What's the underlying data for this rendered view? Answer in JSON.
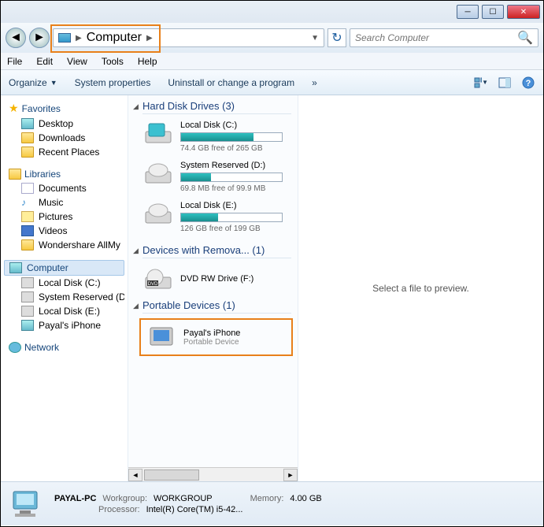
{
  "titlebar": {},
  "breadcrumb": {
    "location": "Computer"
  },
  "search": {
    "placeholder": "Search Computer"
  },
  "menu": {
    "file": "File",
    "edit": "Edit",
    "view": "View",
    "tools": "Tools",
    "help": "Help"
  },
  "toolbar": {
    "organize": "Organize",
    "sysprops": "System properties",
    "uninstall": "Uninstall or change a program",
    "more": "»"
  },
  "sidebar": {
    "favorites": {
      "label": "Favorites",
      "items": [
        {
          "label": "Desktop"
        },
        {
          "label": "Downloads"
        },
        {
          "label": "Recent Places"
        }
      ]
    },
    "libraries": {
      "label": "Libraries",
      "items": [
        {
          "label": "Documents"
        },
        {
          "label": "Music"
        },
        {
          "label": "Pictures"
        },
        {
          "label": "Videos"
        },
        {
          "label": "Wondershare AllMy"
        }
      ]
    },
    "computer": {
      "label": "Computer",
      "items": [
        {
          "label": "Local Disk (C:)"
        },
        {
          "label": "System Reserved (D:"
        },
        {
          "label": "Local Disk (E:)"
        },
        {
          "label": "Payal's iPhone"
        }
      ]
    },
    "network": {
      "label": "Network"
    }
  },
  "content": {
    "hdd": {
      "title": "Hard Disk Drives (3)",
      "drives": [
        {
          "name": "Local Disk (C:)",
          "free": "74.4 GB free of 265 GB",
          "pct": 72
        },
        {
          "name": "System Reserved (D:)",
          "free": "69.8 MB free of 99.9 MB",
          "pct": 30
        },
        {
          "name": "Local Disk (E:)",
          "free": "126 GB free of 199 GB",
          "pct": 37
        }
      ]
    },
    "removable": {
      "title": "Devices with Remova... (1)",
      "items": [
        {
          "name": "DVD RW Drive (F:)"
        }
      ]
    },
    "portable": {
      "title": "Portable Devices (1)",
      "items": [
        {
          "name": "Payal's iPhone",
          "sub": "Portable Device"
        }
      ]
    }
  },
  "preview": {
    "text": "Select a file to preview."
  },
  "status": {
    "pcname": "PAYAL-PC",
    "workgroup_label": "Workgroup:",
    "workgroup": "WORKGROUP",
    "memory_label": "Memory:",
    "memory": "4.00 GB",
    "processor_label": "Processor:",
    "processor": "Intel(R) Core(TM) i5-42..."
  }
}
